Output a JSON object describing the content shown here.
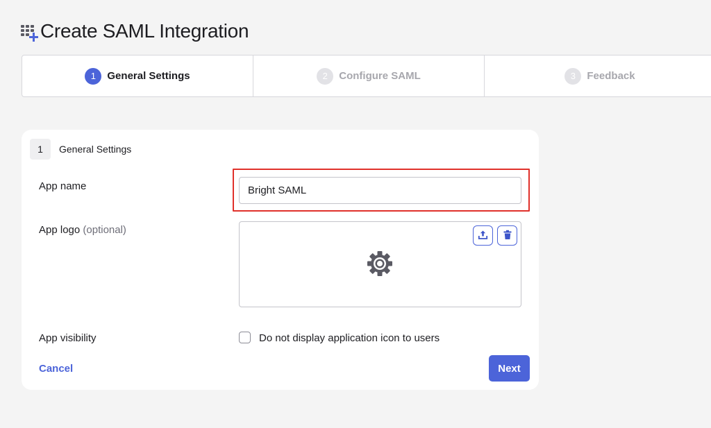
{
  "page": {
    "title": "Create SAML Integration",
    "icon": "app-grid-add-icon"
  },
  "stepper": {
    "steps": [
      {
        "number": "1",
        "label": "General Settings",
        "state": "active"
      },
      {
        "number": "2",
        "label": "Configure SAML",
        "state": "inactive"
      },
      {
        "number": "3",
        "label": "Feedback",
        "state": "inactive"
      }
    ]
  },
  "section": {
    "number": "1",
    "title": "General Settings"
  },
  "form": {
    "app_name": {
      "label": "App name",
      "value": "Bright SAML"
    },
    "app_logo": {
      "label": "App logo",
      "optional": "(optional)",
      "upload_icon": "upload-icon",
      "delete_icon": "trash-icon",
      "placeholder_icon": "gear-icon"
    },
    "app_visibility": {
      "label": "App visibility",
      "checkbox_label": "Do not display application icon to users",
      "checked": false
    }
  },
  "actions": {
    "cancel": "Cancel",
    "next": "Next"
  },
  "colors": {
    "accent": "#4c64d9",
    "highlight": "#e0302a",
    "background": "#f4f4f4"
  }
}
